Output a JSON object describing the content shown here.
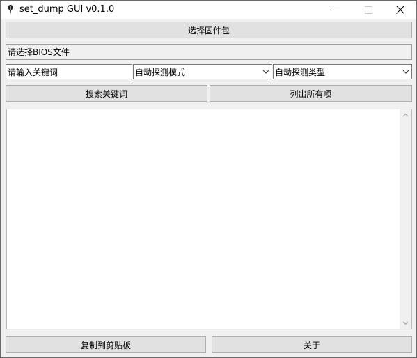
{
  "window": {
    "title": "set_dump GUI v0.1.0",
    "app_icon": "feather-pen-icon",
    "controls": [
      "minimize-icon",
      "maximize-icon",
      "close-icon"
    ]
  },
  "toolbar": {
    "select_firmware_label": "选择固件包"
  },
  "status": {
    "bios_prompt": "请选择BIOS文件"
  },
  "search": {
    "keyword_placeholder": "请输入关键词",
    "mode_selected": "自动探测模式",
    "type_selected": "自动探测类型"
  },
  "actions": {
    "search_label": "搜索关键词",
    "list_all_label": "列出所有项",
    "copy_label": "复制到剪贴板",
    "about_label": "关于"
  },
  "output": {
    "text": ""
  }
}
